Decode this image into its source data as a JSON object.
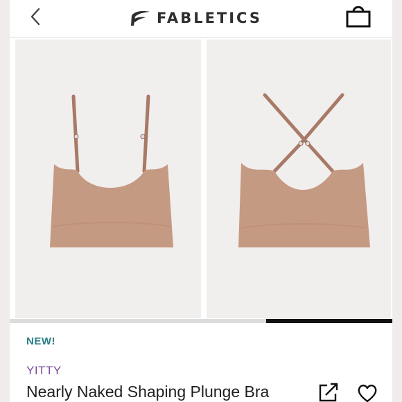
{
  "header": {
    "brand_name": "FABLETICS",
    "icons": {
      "back": "chevron-left-icon",
      "logo": "fabletics-logo-mark",
      "bag": "shopping-bag-icon"
    }
  },
  "gallery": {
    "images": [
      {
        "name": "front view",
        "color": "#c59a83"
      },
      {
        "name": "back view",
        "color": "#c59a83"
      }
    ],
    "progress": 0.33
  },
  "product": {
    "badge": "NEW!",
    "brand": "YITTY",
    "title": "Nearly Naked Shaping Plunge Bra",
    "icons": {
      "share": "share-icon",
      "favorite": "heart-icon"
    }
  },
  "colors": {
    "badge": "#2c7e86",
    "brand": "#7a4ea0",
    "garment": "#c59a83"
  }
}
